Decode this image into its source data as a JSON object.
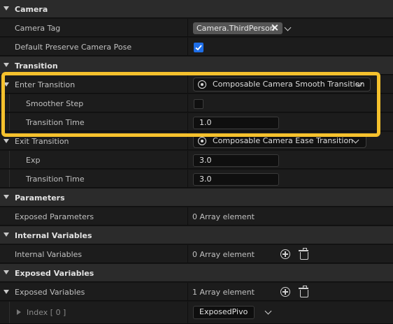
{
  "camera": {
    "header": "Camera",
    "camera_tag_label": "Camera Tag",
    "camera_tag_value": "Camera.ThirdPerson",
    "preserve_pose_label": "Default Preserve Camera Pose",
    "preserve_pose_checked": true
  },
  "transition": {
    "header": "Transition",
    "enter_label": "Enter Transition",
    "enter_value": "Composable Camera Smooth Transition",
    "smoother_step_label": "Smoother Step",
    "smoother_step_checked": false,
    "enter_time_label": "Transition Time",
    "enter_time_value": "1.0",
    "exit_label": "Exit Transition",
    "exit_value": "Composable Camera Ease Transition",
    "exp_label": "Exp",
    "exp_value": "3.0",
    "exit_time_label": "Transition Time",
    "exit_time_value": "3.0"
  },
  "parameters": {
    "header": "Parameters",
    "exposed_label": "Exposed Parameters",
    "exposed_value": "0 Array element"
  },
  "internal": {
    "header": "Internal Variables",
    "label": "Internal Variables",
    "value": "0 Array element"
  },
  "exposed": {
    "header": "Exposed Variables",
    "label": "Exposed Variables",
    "value": "1 Array element",
    "index_label": "Index [ 0 ]",
    "index_value": "ExposedPivo"
  },
  "colors": {
    "highlight": "#f5c12d",
    "checkbox_checked": "#1e6ee8"
  }
}
